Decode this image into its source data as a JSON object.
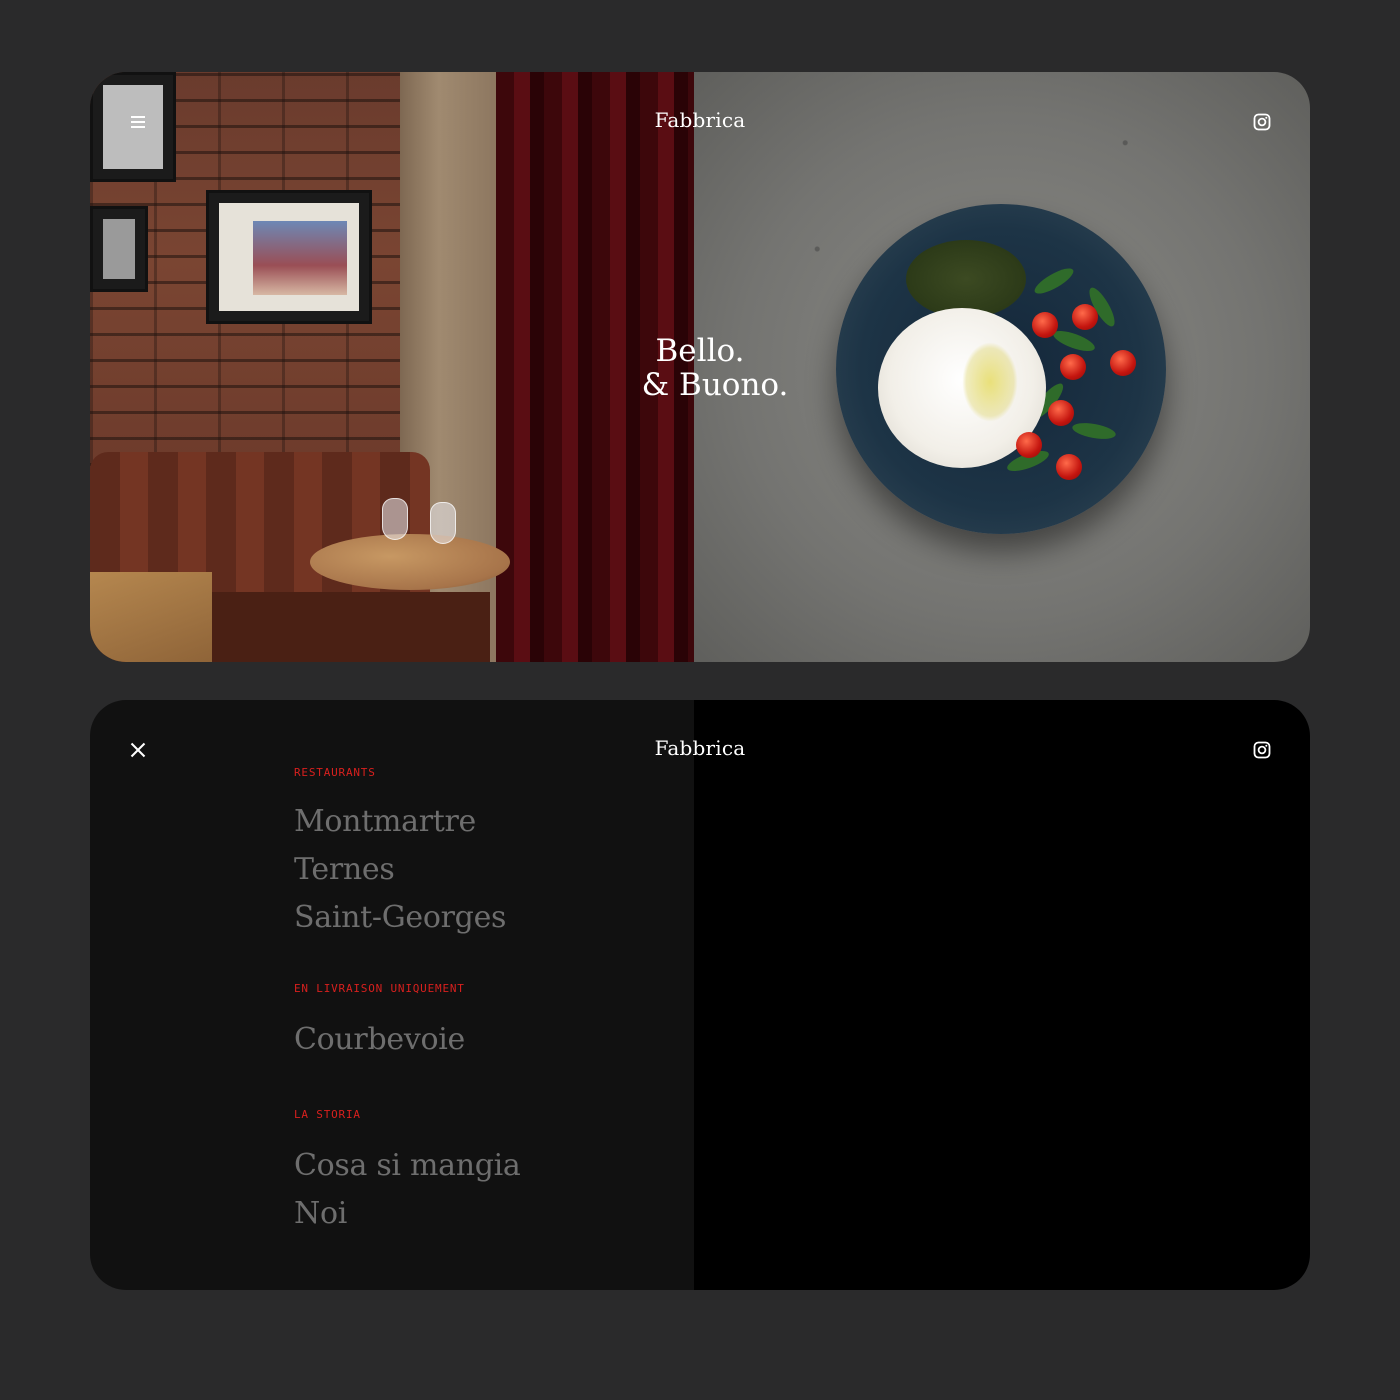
{
  "hero": {
    "brand": "Fabbrica",
    "tagline_line1": "Bello.",
    "tagline_line2": "& Buono.",
    "menu_icon": "hamburger-menu-icon",
    "social_icon": "instagram-icon"
  },
  "menu": {
    "brand": "Fabbrica",
    "close_icon": "close-icon",
    "social_icon": "instagram-icon",
    "sections": [
      {
        "label": "RESTAURANTS",
        "items": [
          "Montmartre",
          "Ternes",
          "Saint-Georges"
        ]
      },
      {
        "label": "EN LIVRAISON UNIQUEMENT",
        "items": [
          "Courbevoie"
        ]
      },
      {
        "label": "LA STORIA",
        "items": [
          "Cosa si mangia",
          "Noi"
        ]
      }
    ]
  },
  "colors": {
    "background": "#2a2a2b",
    "menu_left": "#111111",
    "menu_right": "#000000",
    "section_label": "#d8201e",
    "menu_link": "#6e6e6e",
    "text_light": "#ffffff"
  }
}
